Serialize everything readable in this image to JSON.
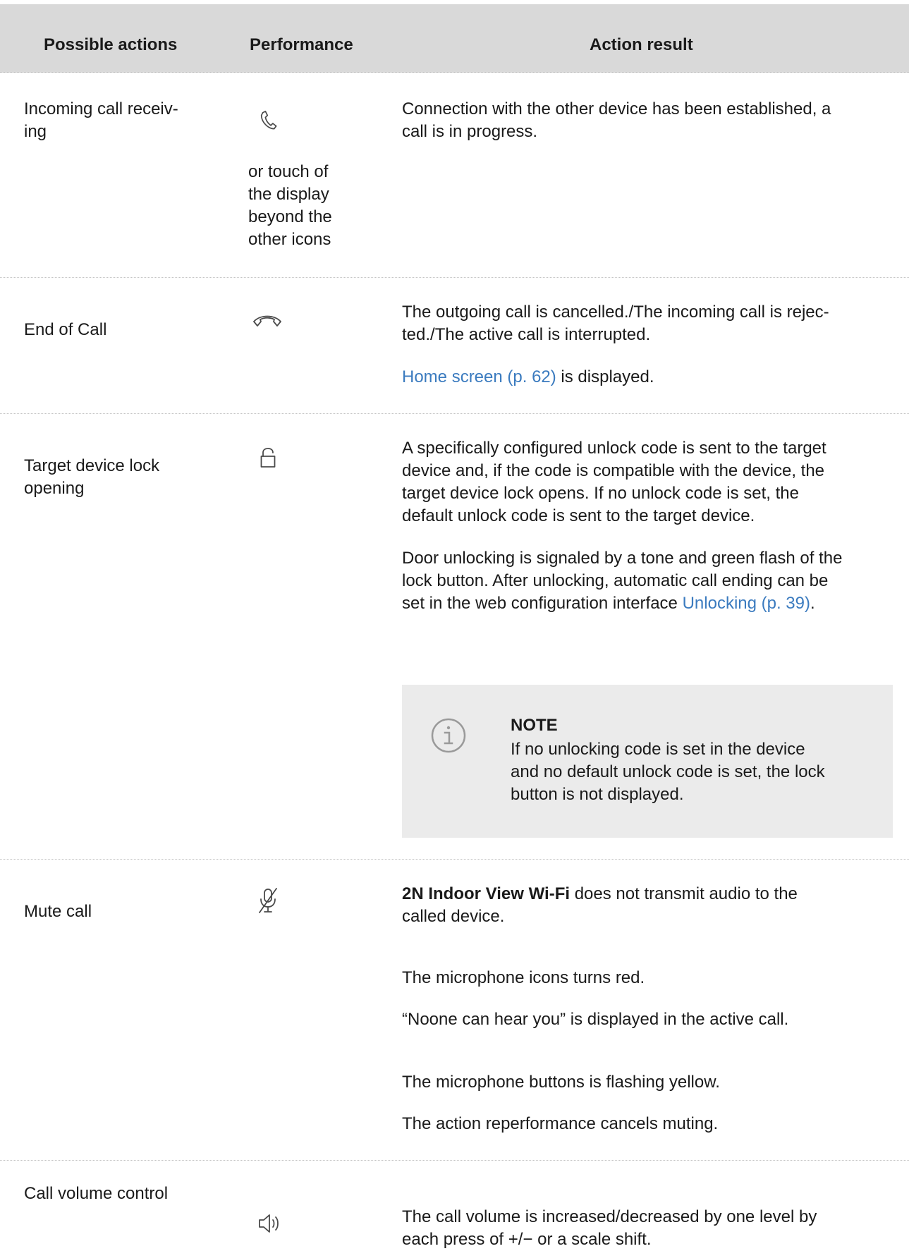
{
  "table": {
    "headers": {
      "col1": "Possible actions",
      "col2": "Performance",
      "col3": "Action result"
    },
    "rows": [
      {
        "action": "Incoming call receiv-\ning",
        "performance_icon": "phone-handset-icon",
        "performance_text": "or touch of\nthe display\nbeyond the\nother icons",
        "result_1": "Connection with the other device has been established, a\ncall is in progress."
      },
      {
        "action": "End of Call",
        "performance_icon": "hang-up-icon",
        "result_1": "The outgoing call is cancelled./The incoming call is rejec-\nted./The active call is interrupted.",
        "result_2_link": "Home screen (p. 62)",
        "result_2_rest": " is displayed."
      },
      {
        "action": "Target device lock\nopening",
        "performance_icon": "unlock-icon",
        "result_1": "A specifically configured unlock code is sent to the target\ndevice and, if the code is compatible with the device, the\ntarget device lock opens. If no unlock code is set, the\ndefault unlock code is sent to the target device.",
        "result_2": "Door unlocking is signaled by a tone and green flash of the\nlock button. After unlocking, automatic call ending can be\nset in the web configuration interface ",
        "result_2_link": "Unlocking (p. 39)",
        "result_2_end": ".",
        "note": {
          "icon": "info-icon",
          "title": "NOTE",
          "text": "If no unlocking code is set in the device\nand no default unlock code is set, the lock\nbutton is not displayed."
        }
      },
      {
        "action": "Mute call",
        "performance_icon": "microphone-muted-icon",
        "result_1_bold": "2N Indoor View Wi-Fi",
        "result_1_rest": " does not transmit audio to the\ncalled device.",
        "result_2": "The microphone icons turns red.",
        "result_3": "“Noone can hear you” is displayed in the active call.",
        "result_4": "The microphone buttons is flashing yellow.",
        "result_5": "The action reperformance cancels muting."
      },
      {
        "action": "Call volume control",
        "performance_icon": "speaker-volume-icon",
        "result_1": "The call volume is increased/decreased by one level by\neach press of +/− or a scale shift."
      }
    ]
  },
  "colors": {
    "header_bg": "#d9d9d9",
    "note_bg": "#ebebeb",
    "link": "#3b7bbf",
    "icon": "#4a4a4a",
    "note_icon": "#9a9a9a"
  }
}
